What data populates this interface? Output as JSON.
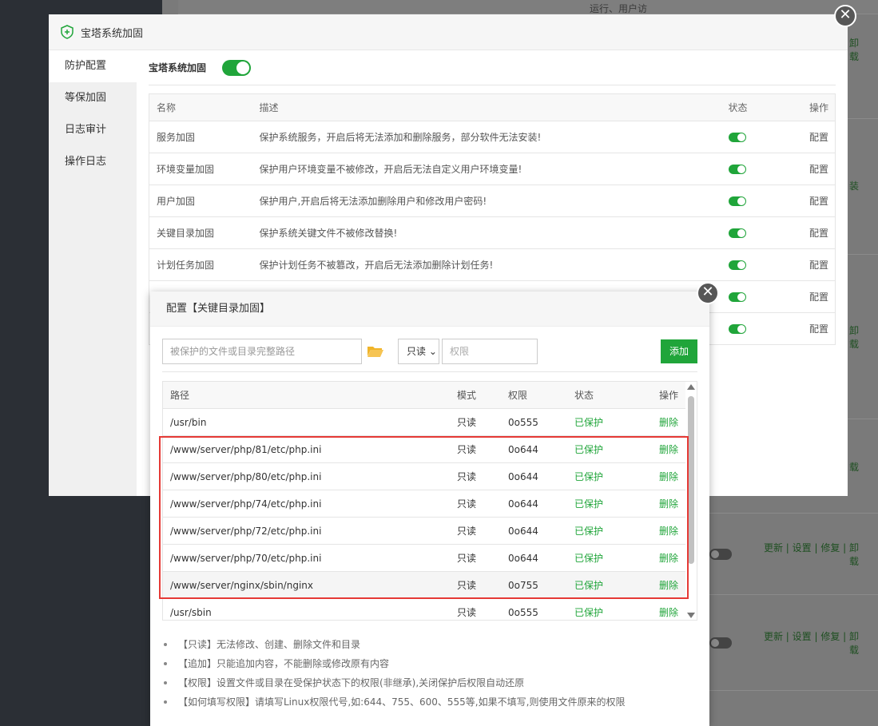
{
  "background": {
    "top_text": "运行、用户访",
    "side_texts": [
      "卸",
      "载",
      "装",
      "卸",
      "载",
      "载"
    ],
    "action_rows": [
      {
        "line1": "更新 | 设置 | 修复 | 卸",
        "line2": "载"
      },
      {
        "line1": "更新 | 设置 | 修复 | 卸",
        "line2": "载"
      }
    ]
  },
  "outer_dialog": {
    "title": "宝塔系统加固",
    "sidebar": [
      {
        "label": "防护配置"
      },
      {
        "label": "等保加固"
      },
      {
        "label": "日志审计"
      },
      {
        "label": "操作日志"
      }
    ],
    "system_toggle_label": "宝塔系统加固",
    "table": {
      "headers": {
        "name": "名称",
        "desc": "描述",
        "status": "状态",
        "op": "操作"
      },
      "rows": [
        {
          "name": "服务加固",
          "desc": "保护系统服务，开启后将无法添加和删除服务，部分软件无法安装!",
          "op": "配置"
        },
        {
          "name": "环境变量加固",
          "desc": "保护用户环境变量不被修改，开启后无法自定义用户环境变量!",
          "op": "配置"
        },
        {
          "name": "用户加固",
          "desc": "保护用户,开启后将无法添加删除用户和修改用户密码!",
          "op": "配置"
        },
        {
          "name": "关键目录加固",
          "desc": "保护系统关键文件不被修改替换!",
          "op": "配置"
        },
        {
          "name": "计划任务加固",
          "desc": "保护计划任务不被篡改，开启后无法添加删除计划任务!",
          "op": "配置"
        },
        {
          "name": "",
          "desc": "",
          "op": "配置"
        },
        {
          "name": "",
          "desc": "",
          "op": "配置"
        }
      ]
    }
  },
  "inner_dialog": {
    "title": "配置【关键目录加固】",
    "path_placeholder": "被保护的文件或目录完整路径",
    "mode_value": "只读",
    "perm_placeholder": "权限",
    "add_label": "添加",
    "list_headers": {
      "path": "路径",
      "mode": "模式",
      "perm": "权限",
      "status": "状态",
      "op": "操作"
    },
    "rows": [
      {
        "path": "/usr/bin",
        "mode": "只读",
        "perm": "0o555",
        "status": "已保护",
        "op": "删除"
      },
      {
        "path": "/www/server/php/81/etc/php.ini",
        "mode": "只读",
        "perm": "0o644",
        "status": "已保护",
        "op": "删除"
      },
      {
        "path": "/www/server/php/80/etc/php.ini",
        "mode": "只读",
        "perm": "0o644",
        "status": "已保护",
        "op": "删除"
      },
      {
        "path": "/www/server/php/74/etc/php.ini",
        "mode": "只读",
        "perm": "0o644",
        "status": "已保护",
        "op": "删除"
      },
      {
        "path": "/www/server/php/72/etc/php.ini",
        "mode": "只读",
        "perm": "0o644",
        "status": "已保护",
        "op": "删除"
      },
      {
        "path": "/www/server/php/70/etc/php.ini",
        "mode": "只读",
        "perm": "0o644",
        "status": "已保护",
        "op": "删除"
      },
      {
        "path": "/www/server/nginx/sbin/nginx",
        "mode": "只读",
        "perm": "0o755",
        "status": "已保护",
        "op": "删除"
      },
      {
        "path": "/usr/sbin",
        "mode": "只读",
        "perm": "0o555",
        "status": "已保护",
        "op": "删除"
      }
    ],
    "notes": [
      "【只读】无法修改、创建、删除文件和目录",
      "【追加】只能追加内容，不能删除或修改原有内容",
      "【权限】设置文件或目录在受保护状态下的权限(非继承),关闭保护后权限自动还原",
      "【如何填写权限】请填写Linux权限代号,如:644、755、600、555等,如果不填写,则使用文件原来的权限"
    ]
  },
  "colors": {
    "accent": "#20a53a",
    "highlight": "#e53935"
  }
}
